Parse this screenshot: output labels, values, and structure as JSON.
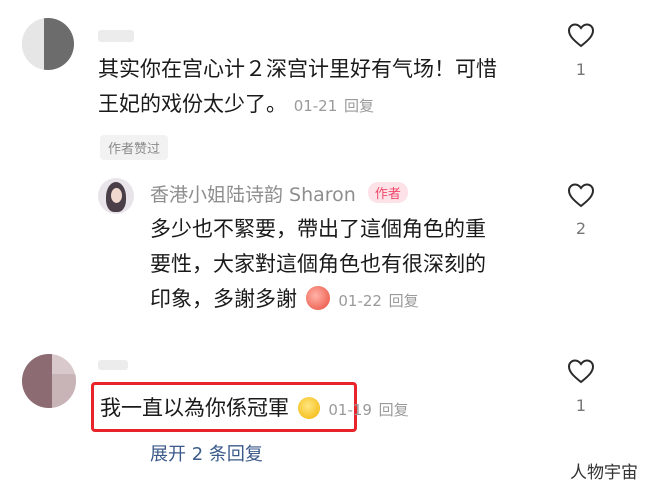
{
  "comments": [
    {
      "text_line1": "其实你在宫心计２深宫计里好有气场！可惜",
      "text_line2": "王妃的戏份太少了。",
      "date": "01-21",
      "reply_label": "回复",
      "likes": "1",
      "author_liked_chip": "作者赞过"
    },
    {
      "author_name": "香港小姐陆诗韵 Sharon",
      "author_badge": "作者",
      "text_line1": "多少也不緊要，帶出了這個角色的重",
      "text_line2": "要性，大家對這個角色也有很深刻的",
      "text_line3": "印象，多謝多謝",
      "date": "01-22",
      "reply_label": "回复",
      "likes": "2"
    },
    {
      "text": "我一直以為你係冠軍",
      "date": "01-19",
      "reply_label": "回复",
      "likes": "1",
      "expand_label": "展开 2 条回复"
    }
  ],
  "watermark": "人物宇宙",
  "colors": {
    "highlight_box": "#e8232a",
    "badge_bg": "#fde3e8",
    "badge_fg": "#f0486a"
  },
  "icons": [
    "heart-outline-icon",
    "apple-emoji-icon",
    "grin-sweat-emoji-icon"
  ]
}
